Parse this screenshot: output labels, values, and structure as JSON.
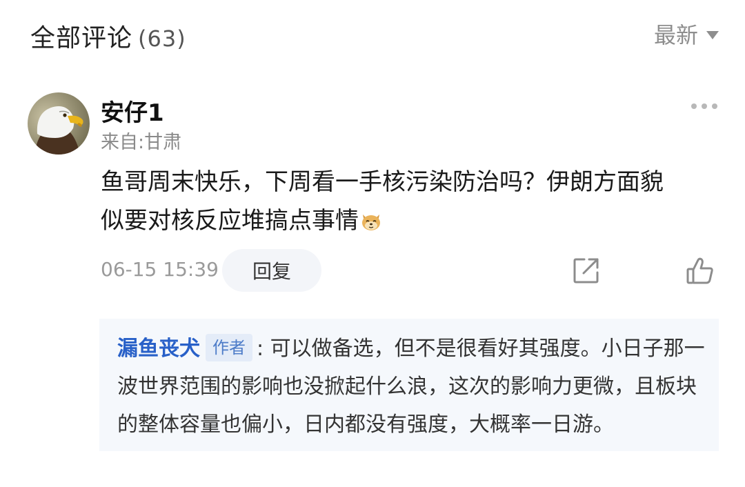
{
  "header": {
    "title": "全部评论",
    "count": "(63)",
    "sort_label": "最新"
  },
  "comment": {
    "username": "安仔1",
    "location": "来自:甘肃",
    "text_line1": "鱼哥周末快乐，下周看一手核污染防治吗？伊朗方面貌",
    "text_line2": "似要对核反应堆搞点事情",
    "emoji": "doge-emoji",
    "time": "06-15 15:39",
    "reply_label": "回复",
    "icons": [
      "more-icon",
      "share-icon",
      "like-icon"
    ]
  },
  "reply": {
    "author": "漏鱼丧犬",
    "badge": "作者",
    "text": ": 可以做备选，但不是很看好其强度。小日子那一波世界范围的影响也没掀起什么浪，这次的影响力更微，且板块的整体容量也偏小，日内都没有强度，大概率一日游。"
  },
  "colors": {
    "author_blue": "#2860c8",
    "reply_bg": "#f5f8fc",
    "muted_text": "#8a8a8a"
  }
}
